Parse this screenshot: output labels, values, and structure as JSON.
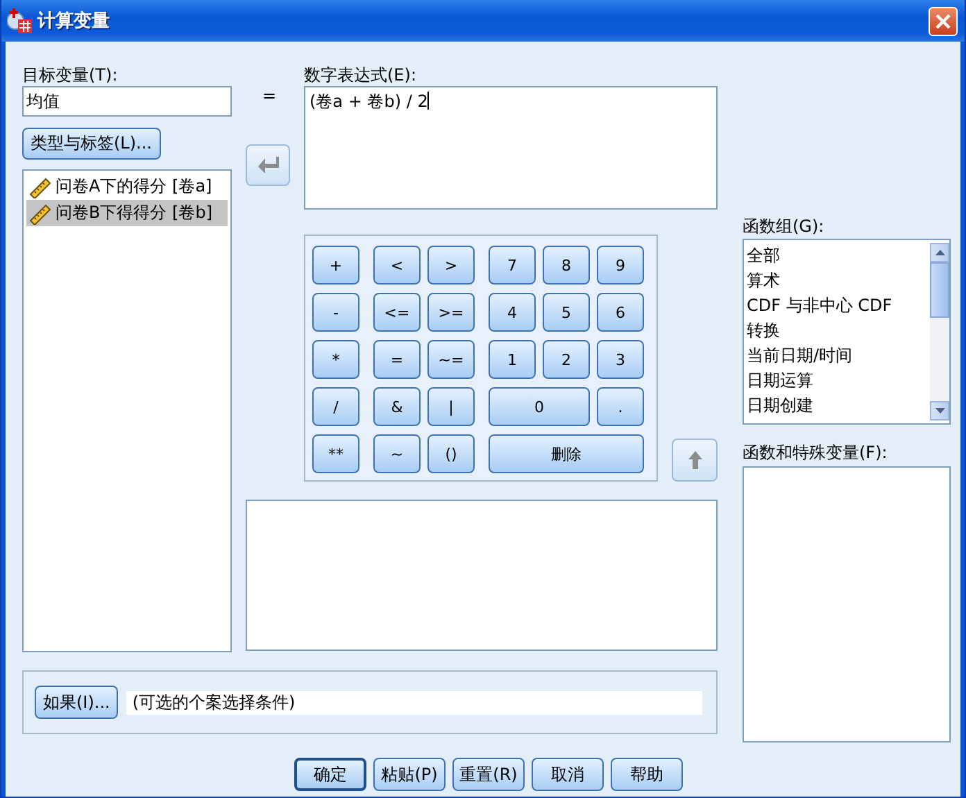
{
  "window": {
    "title": "计算变量"
  },
  "target_variable": {
    "label": "目标变量(T):",
    "value": "均值"
  },
  "type_label_button": "类型与标签(L)...",
  "variables": [
    {
      "label": "问卷A下的得分 [卷a]",
      "selected": false
    },
    {
      "label": "问卷B下得得分 [卷b]",
      "selected": true
    }
  ],
  "equals": "=",
  "expression": {
    "label": "数字表达式(E):",
    "value": "(卷a + 卷b) / 2"
  },
  "keypad": [
    [
      {
        "label": "+",
        "kind": "single"
      },
      {
        "label": "<",
        "kind": "single"
      },
      {
        "label": ">",
        "kind": "single"
      },
      {
        "label": "7",
        "kind": "single"
      },
      {
        "label": "8",
        "kind": "single"
      },
      {
        "label": "9",
        "kind": "single"
      }
    ],
    [
      {
        "label": "-",
        "kind": "single"
      },
      {
        "label": "<=",
        "kind": "single"
      },
      {
        "label": ">=",
        "kind": "single"
      },
      {
        "label": "4",
        "kind": "single"
      },
      {
        "label": "5",
        "kind": "single"
      },
      {
        "label": "6",
        "kind": "single"
      }
    ],
    [
      {
        "label": "*",
        "kind": "single"
      },
      {
        "label": "=",
        "kind": "single"
      },
      {
        "label": "~=",
        "kind": "single"
      },
      {
        "label": "1",
        "kind": "single"
      },
      {
        "label": "2",
        "kind": "single"
      },
      {
        "label": "3",
        "kind": "single"
      }
    ],
    [
      {
        "label": "/",
        "kind": "single"
      },
      {
        "label": "&",
        "kind": "single"
      },
      {
        "label": "|",
        "kind": "single"
      },
      {
        "label": "0",
        "kind": "double"
      },
      {
        "label": ".",
        "kind": "single"
      }
    ],
    [
      {
        "label": "**",
        "kind": "single"
      },
      {
        "label": "~",
        "kind": "single"
      },
      {
        "label": "()",
        "kind": "single"
      },
      {
        "label": "删除",
        "kind": "triple"
      }
    ]
  ],
  "function_group": {
    "label": "函数组(G):",
    "items": [
      "全部",
      "算术",
      "CDF 与非中心 CDF",
      "转换",
      "当前日期/时间",
      "日期运算",
      "日期创建"
    ]
  },
  "functions": {
    "label": "函数和特殊变量(F):"
  },
  "if_button": "如果(I)...",
  "if_condition": "(可选的个案选择条件)",
  "buttons": [
    {
      "label": "确定",
      "default": true
    },
    {
      "label": "粘贴(P)",
      "default": false
    },
    {
      "label": "重置(R)",
      "default": false
    },
    {
      "label": "取消",
      "default": false
    },
    {
      "label": "帮助",
      "default": false
    }
  ]
}
